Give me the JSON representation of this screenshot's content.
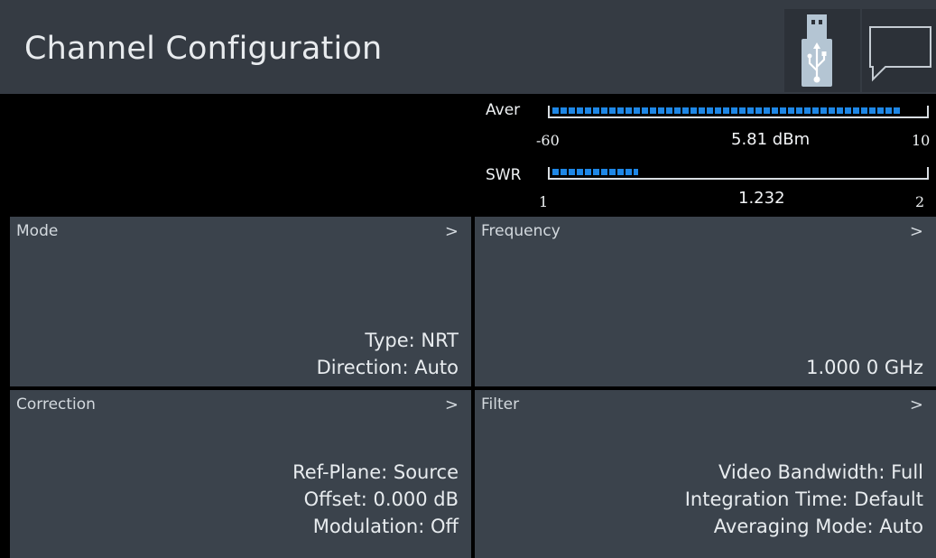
{
  "header": {
    "title": "Channel Configuration",
    "usb_icon": "usb-drive-icon",
    "message_icon": "speech-bubble-icon"
  },
  "meters": {
    "average": {
      "label": "Aver",
      "min": "-60",
      "max": "10",
      "value": "5.81 dBm",
      "fill_fraction": 0.94
    },
    "swr": {
      "label": "SWR",
      "min": "1",
      "max": "2",
      "value": "1.232",
      "fill_fraction": 0.23
    }
  },
  "panels": {
    "mode": {
      "title": "Mode",
      "chevron": ">",
      "lines": [
        "Type: NRT",
        "Direction: Auto"
      ]
    },
    "frequency": {
      "title": "Frequency",
      "chevron": ">",
      "lines": [
        "1.000 0 GHz"
      ]
    },
    "correction": {
      "title": "Correction",
      "chevron": ">",
      "lines": [
        "Ref-Plane: Source",
        "Offset: 0.000 dB",
        "Modulation: Off"
      ]
    },
    "filter": {
      "title": "Filter",
      "chevron": ">",
      "lines": [
        "Video Bandwidth: Full",
        "Integration Time: Default",
        "Averaging Mode: Auto"
      ]
    }
  },
  "colors": {
    "header_bg": "#353b43",
    "panel_bg": "#3b434c",
    "bar_accent": "#1e87e6"
  }
}
